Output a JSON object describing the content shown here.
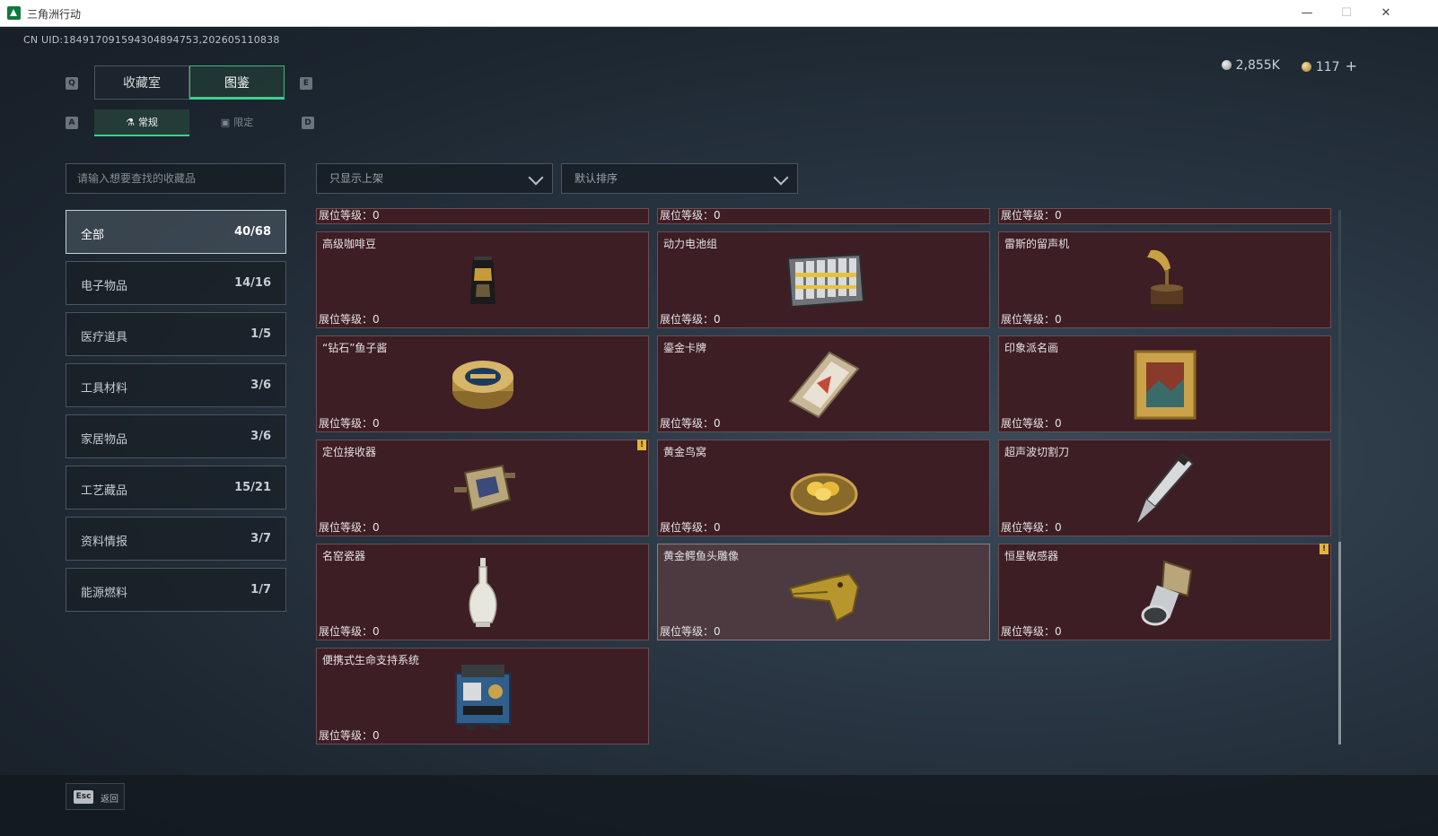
{
  "window": {
    "title": "三角洲行动",
    "controls": {
      "minimize": "—",
      "maximize": "☐",
      "close": "✕"
    }
  },
  "uid": "CN UID:184917091594304894753,202605110838",
  "currency": {
    "silver": "2,855K",
    "gold": "117",
    "add": "+"
  },
  "key_hints": {
    "tab_left": "Q",
    "tab_right": "E",
    "sub_left": "A",
    "sub_right": "D"
  },
  "tabs": [
    {
      "label": "收藏室",
      "active": false
    },
    {
      "label": "图鉴",
      "active": true
    }
  ],
  "sub_tabs": [
    {
      "label": "常规",
      "icon": "flask-icon",
      "active": true
    },
    {
      "label": "限定",
      "icon": "image-icon",
      "active": false
    }
  ],
  "search": {
    "placeholder": "请输入想要查找的收藏品"
  },
  "filter": {
    "selected": "只显示上架"
  },
  "sort": {
    "selected": "默认排序"
  },
  "categories": [
    {
      "name": "全部",
      "count": "40/68",
      "active": true
    },
    {
      "name": "电子物品",
      "count": "14/16"
    },
    {
      "name": "医疗道具",
      "count": "1/5"
    },
    {
      "name": "工具材料",
      "count": "3/6"
    },
    {
      "name": "家居物品",
      "count": "3/6"
    },
    {
      "name": "工艺藏品",
      "count": "15/21"
    },
    {
      "name": "资料情报",
      "count": "3/7"
    },
    {
      "name": "能源燃料",
      "count": "1/7"
    }
  ],
  "level_label": "展位等级：0",
  "items": [
    {
      "name": "高级咖啡豆",
      "icon": "coffee-bag-icon"
    },
    {
      "name": "动力电池组",
      "icon": "battery-pack-icon"
    },
    {
      "name": "雷斯的留声机",
      "icon": "gramophone-icon"
    },
    {
      "name": "“钻石”鱼子酱",
      "icon": "caviar-tin-icon"
    },
    {
      "name": "鎏金卡牌",
      "icon": "card-icon"
    },
    {
      "name": "印象派名画",
      "icon": "painting-icon"
    },
    {
      "name": "定位接收器",
      "icon": "receiver-icon",
      "warn": "!"
    },
    {
      "name": "黄金鸟窝",
      "icon": "golden-nest-icon"
    },
    {
      "name": "超声波切割刀",
      "icon": "ultrasonic-knife-icon"
    },
    {
      "name": "名窑瓷器",
      "icon": "porcelain-vase-icon"
    },
    {
      "name": "黄金鳄鱼头雕像",
      "icon": "crocodile-statue-icon",
      "highlight": true
    },
    {
      "name": "恒星敏感器",
      "icon": "star-sensor-icon",
      "warn": "!"
    },
    {
      "name": "便携式生命支持系统",
      "icon": "life-support-icon"
    }
  ],
  "bottom": {
    "esc_key": "Esc",
    "esc_label": "返回"
  }
}
